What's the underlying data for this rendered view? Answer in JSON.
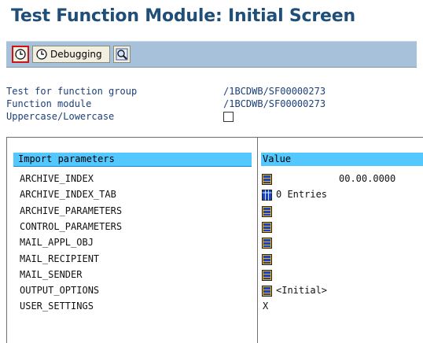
{
  "window": {
    "title": "Test Function Module: Initial Screen"
  },
  "toolbar": {
    "execute_icon": "execute-clock-icon",
    "debugging_label": "Debugging",
    "debugging_icon": "debugging-clock-icon",
    "finder_icon": "magnifier-icon"
  },
  "info": {
    "function_group_label": "Test for function group",
    "function_group_value": "/1BCDWB/SF00000273",
    "function_module_label": "Function module",
    "function_module_value": "/1BCDWB/SF00000273",
    "case_label": "Uppercase/Lowercase",
    "case_checked": false
  },
  "table": {
    "header_param": "Import parameters",
    "header_value": "Value",
    "rows": [
      {
        "name": "ARCHIVE_INDEX",
        "icon": "structure-icon",
        "value": "00.00.0000"
      },
      {
        "name": "ARCHIVE_INDEX_TAB",
        "icon": "table-icon",
        "value": "0 Entries"
      },
      {
        "name": "ARCHIVE_PARAMETERS",
        "icon": "structure-icon",
        "value": ""
      },
      {
        "name": "CONTROL_PARAMETERS",
        "icon": "structure-icon",
        "value": ""
      },
      {
        "name": "MAIL_APPL_OBJ",
        "icon": "structure-icon",
        "value": ""
      },
      {
        "name": "MAIL_RECIPIENT",
        "icon": "structure-icon",
        "value": ""
      },
      {
        "name": "MAIL_SENDER",
        "icon": "structure-icon",
        "value": ""
      },
      {
        "name": "OUTPUT_OPTIONS",
        "icon": "structure-icon",
        "value": "<Initial>"
      },
      {
        "name": "USER_SETTINGS",
        "icon": "",
        "value": "X"
      }
    ]
  },
  "colors": {
    "title": "#1f4f78",
    "toolbar": "#a7c1db",
    "header_bg": "#52c8ff",
    "info_text": "#1c3f7a",
    "execute_border": "#d01212"
  }
}
